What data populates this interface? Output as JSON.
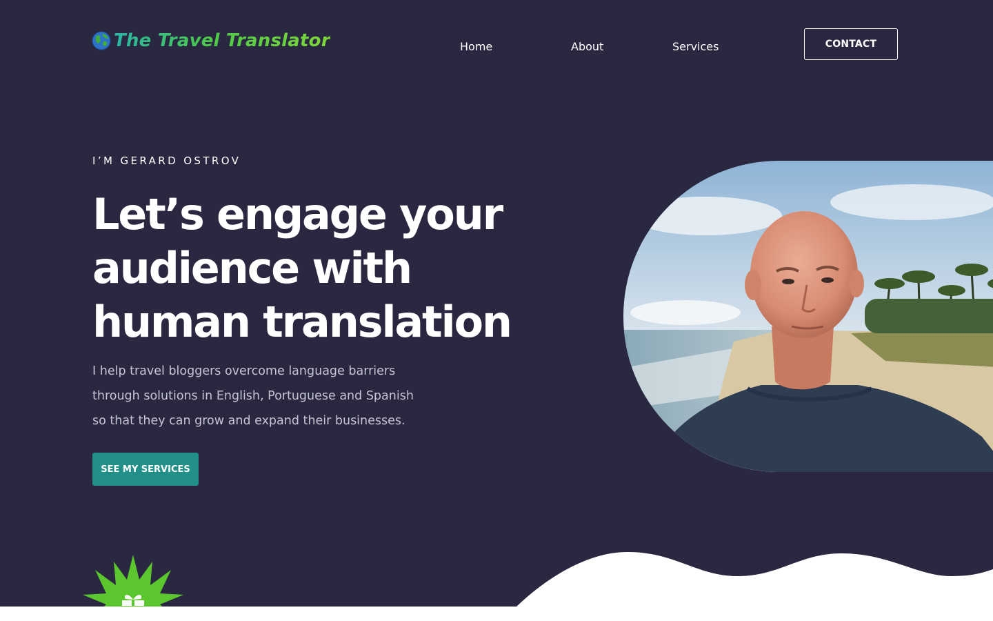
{
  "header": {
    "logo_text": "The Travel Translator",
    "nav": {
      "home": "Home",
      "about": "About",
      "services": "Services"
    },
    "contact_label": "CONTACT"
  },
  "hero": {
    "eyebrow": "I’M GERARD OSTROV",
    "headline_lines": [
      "Let’s engage your",
      "audience with",
      "human translation"
    ],
    "lead_lines": [
      "I help travel bloggers overcome language barriers",
      "through solutions in English, Portuguese and Spanish",
      "so that they can grow and expand their businesses."
    ],
    "cta_label": "SEE MY SERVICES"
  },
  "colors": {
    "hero_background": "#2a2841",
    "accent_teal": "#228f88",
    "logo_green": "#4ec94a",
    "badge_green": "#5cc62f",
    "text_white": "#ffffff",
    "text_muted": "#c5c5d3"
  },
  "icons": {
    "logo": "globe-icon",
    "badge": "gift-icon"
  }
}
